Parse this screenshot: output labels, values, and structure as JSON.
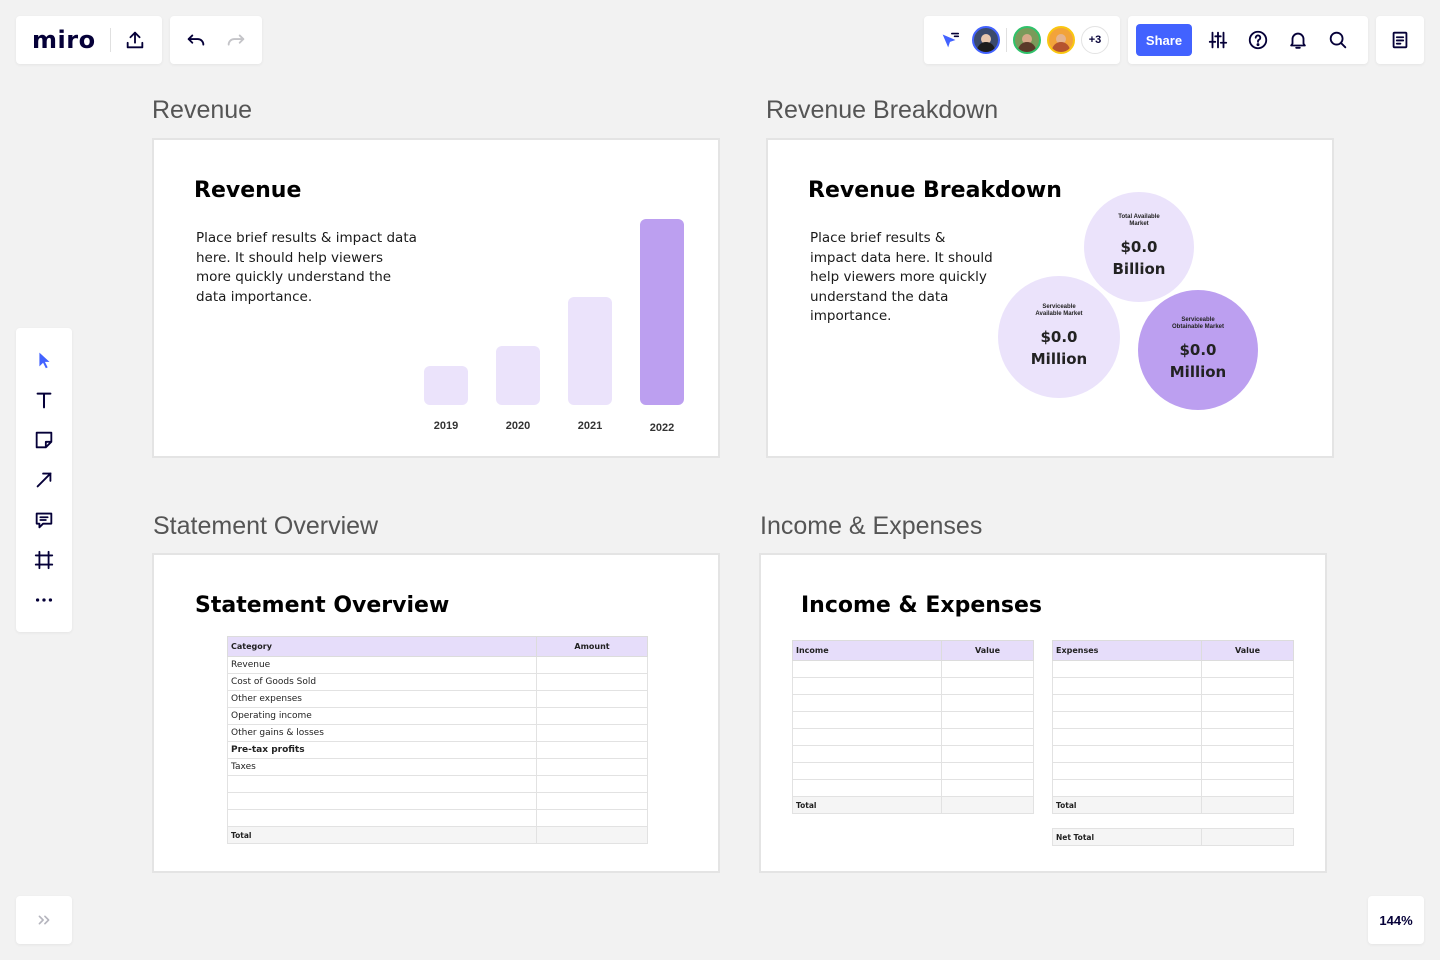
{
  "app": {
    "logo": "miro"
  },
  "collaborators": {
    "extra_count": "+3"
  },
  "toolbar_top": {
    "share_label": "Share"
  },
  "zoom": "144%",
  "frames": {
    "revenue": {
      "frame_title": "Revenue",
      "title": "Revenue",
      "body": "Place brief results & impact data here. It should help viewers more quickly understand the data importance.",
      "chart_data": {
        "type": "bar",
        "categories": [
          "2019",
          "2020",
          "2021",
          "2022"
        ],
        "values": [
          2,
          3,
          5.5,
          9.5
        ],
        "colors": [
          "#ebe3fb",
          "#ebe3fb",
          "#ebe3fb",
          "#bc9ff0"
        ],
        "title": "",
        "xlabel": "",
        "ylabel": ""
      }
    },
    "breakdown": {
      "frame_title": "Revenue Breakdown",
      "title": "Revenue Breakdown",
      "body": "Place brief results & impact data here. It should help viewers more quickly understand the data importance.",
      "circles": [
        {
          "caption": "Total Available Market",
          "value_line1": "$0.0",
          "value_line2": "Billion",
          "color": "#ebe3fb"
        },
        {
          "caption": "Serviceable Available Market",
          "value_line1": "$0.0",
          "value_line2": "Million",
          "color": "#ebe3fb"
        },
        {
          "caption": "Serviceable Obtainable Market",
          "value_line1": "$0.0",
          "value_line2": "Million",
          "color": "#bc9ff0"
        }
      ]
    },
    "statement": {
      "frame_title": "Statement Overview",
      "title": "Statement Overview",
      "columns": [
        "Category",
        "Amount"
      ],
      "rows": [
        "Revenue",
        "Cost of Goods Sold",
        "Other expenses",
        "Operating income",
        "Other gains & losses",
        "Pre-tax profits",
        "Taxes",
        "",
        "",
        ""
      ],
      "total_label": "Total"
    },
    "income": {
      "frame_title": "Income & Expenses",
      "title": "Income & Expenses",
      "income_columns": [
        "Income",
        "Value"
      ],
      "expense_columns": [
        "Expenses",
        "Value"
      ],
      "total_label": "Total",
      "net_total_label": "Net Total"
    }
  }
}
